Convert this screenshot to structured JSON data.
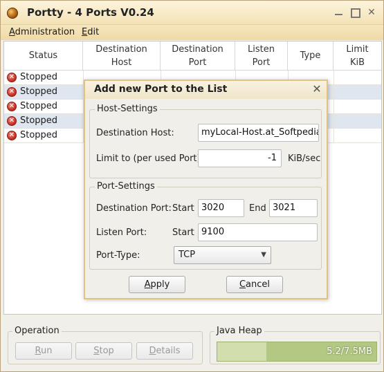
{
  "window": {
    "title": "Portty - 4 Ports V0.24",
    "controls": {
      "minimize": "",
      "maximize": "",
      "close": "✕"
    }
  },
  "menu": {
    "items": [
      {
        "label_ul": "A",
        "label_rest": "dministration",
        "hotkey_index": 0
      },
      {
        "label_ul": "E",
        "label_rest": "dit"
      }
    ]
  },
  "table": {
    "columns": [
      {
        "label": "Status"
      },
      {
        "label_line1": "Destination",
        "label_line2": "Host"
      },
      {
        "label_line1": "Destination",
        "label_line2": "Port"
      },
      {
        "label_line1": "Listen",
        "label_line2": "Port"
      },
      {
        "label": "Type"
      },
      {
        "label_line1": "Limit",
        "label_line2": "KiB"
      }
    ],
    "rows": [
      {
        "status": "Stopped"
      },
      {
        "status": "Stopped"
      },
      {
        "status": "Stopped"
      },
      {
        "status": "Stopped"
      },
      {
        "status": "Stopped"
      }
    ]
  },
  "operation": {
    "legend": "Operation",
    "run": {
      "ul": "R",
      "rest": "un"
    },
    "stop": {
      "ul": "S",
      "rest": "top"
    },
    "details": {
      "ul": "D",
      "rest": "etails"
    }
  },
  "java_heap": {
    "legend": "Java Heap",
    "value": "5.2/7.5MB",
    "used_fraction": 0.69
  },
  "dialog": {
    "title": "Add new Port to the List",
    "close": "✕",
    "host_settings": {
      "legend": "Host-Settings",
      "destination_host_label": "Destination Host:",
      "destination_host_value": "myLocal-Host.at_Softpedia.",
      "limit_label": "Limit to (per used Port):",
      "limit_value": "-1",
      "limit_unit": "KiB/sec"
    },
    "port_settings": {
      "legend": "Port-Settings",
      "destination_port_label": "Destination Port:",
      "start_label": "Start",
      "dest_start_value": "3020",
      "end_label": "End",
      "dest_end_value": "3021",
      "listen_port_label": "Listen Port:",
      "listen_start_label": "Start",
      "listen_start_value": "9100",
      "port_type_label": "Port-Type:",
      "port_type_value": "TCP"
    },
    "apply": {
      "ul": "A",
      "rest": "pply"
    },
    "cancel": {
      "ul": "C",
      "rest": "ancel"
    }
  }
}
